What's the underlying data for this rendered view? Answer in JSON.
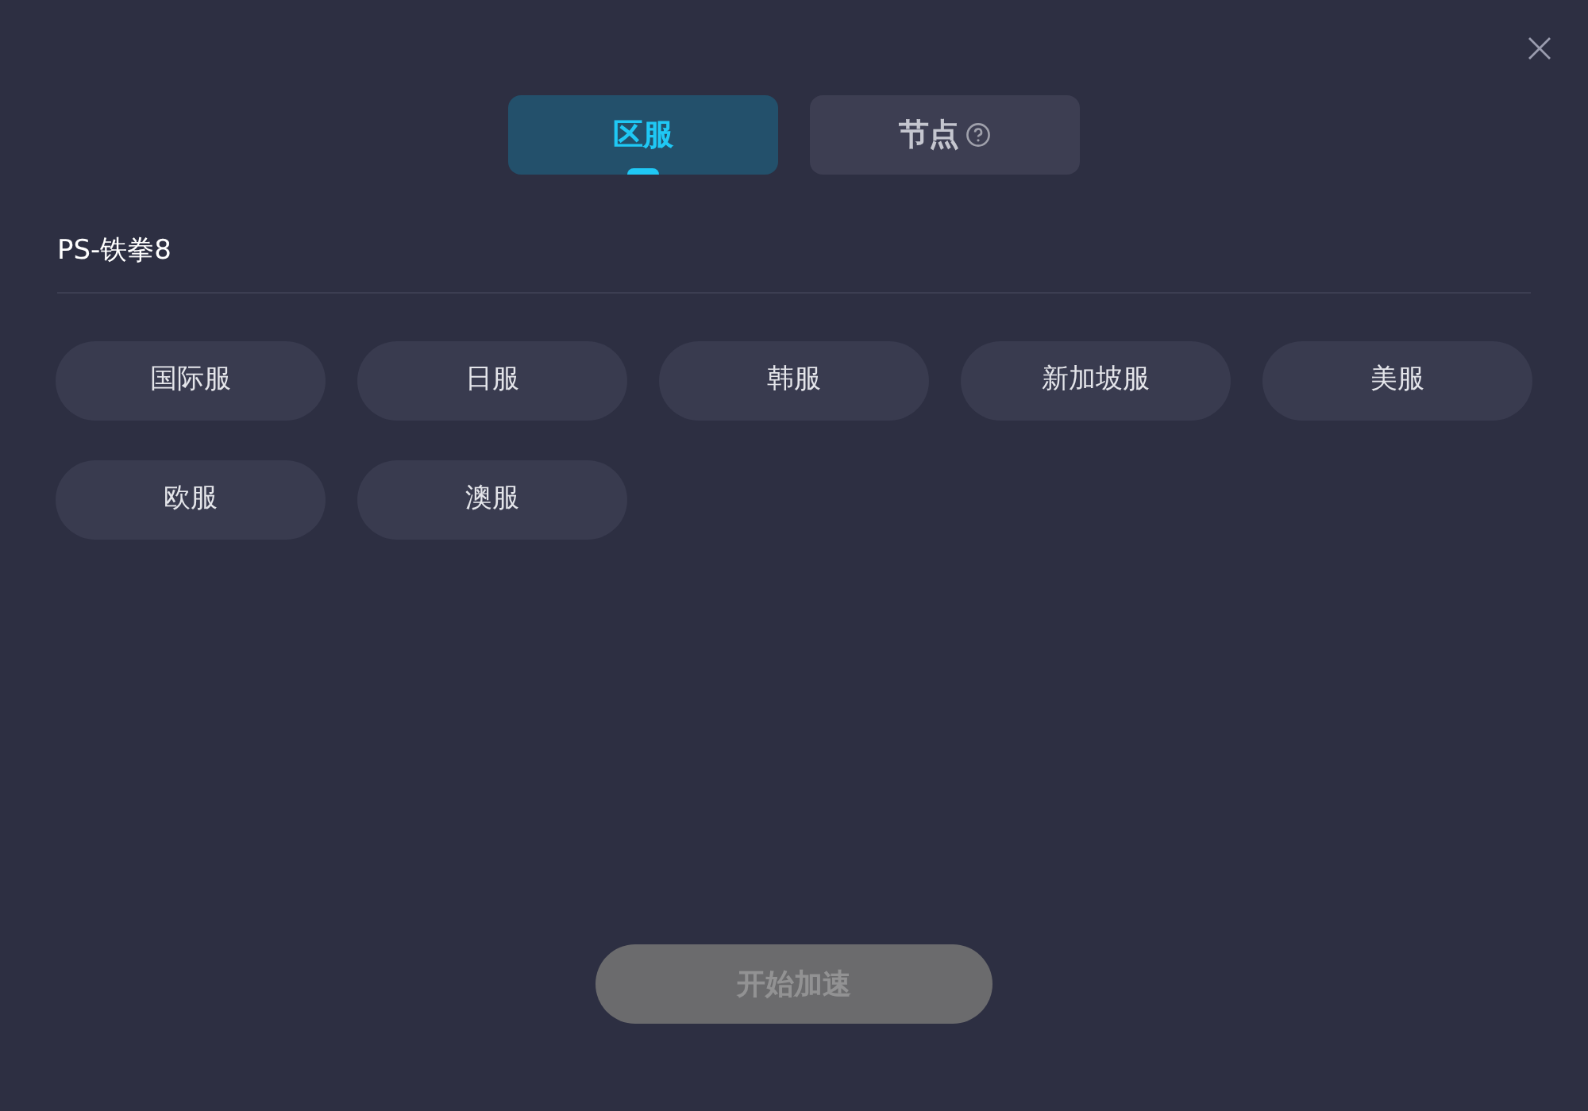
{
  "tabs": [
    {
      "label": "区服",
      "selected": true,
      "help": false
    },
    {
      "label": "节点",
      "selected": false,
      "help": true
    }
  ],
  "game_title": "PS-铁拳8",
  "servers": [
    {
      "label": "国际服",
      "selected": false
    },
    {
      "label": "日服",
      "selected": false
    },
    {
      "label": "韩服",
      "selected": false
    },
    {
      "label": "新加坡服",
      "selected": false
    },
    {
      "label": "美服",
      "selected": false
    },
    {
      "label": "欧服",
      "selected": false
    },
    {
      "label": "澳服",
      "selected": false
    }
  ],
  "start_button": {
    "label": "开始加速",
    "disabled": true
  }
}
